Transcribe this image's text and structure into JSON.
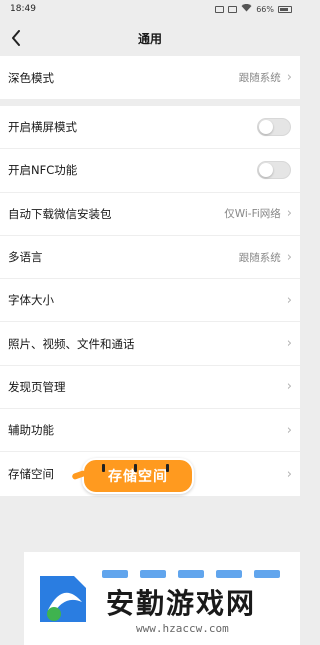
{
  "status_bar": {
    "time": "18:49",
    "battery": "66%"
  },
  "nav": {
    "title": "通用"
  },
  "group1": [
    {
      "label": "深色模式",
      "value": "跟随系统"
    }
  ],
  "group2": [
    {
      "label": "开启横屏模式"
    },
    {
      "label": "开启NFC功能"
    },
    {
      "label": "自动下载微信安装包",
      "value": "仅Wi-Fi网络"
    },
    {
      "label": "多语言",
      "value": "跟随系统"
    },
    {
      "label": "字体大小"
    },
    {
      "label": "照片、视频、文件和通话"
    },
    {
      "label": "发现页管理"
    },
    {
      "label": "辅助功能"
    },
    {
      "label": "存储空间"
    }
  ],
  "toggles": {
    "landscape": false,
    "nfc": false
  },
  "sticker": {
    "text": "存储空间",
    "color": "#ff9a1f"
  },
  "watermark": {
    "title": "安勤游戏网",
    "url": "www.hzaccw.com"
  },
  "icons": {
    "back": "back-arrow-icon",
    "chevron": "chevron-right-icon"
  }
}
